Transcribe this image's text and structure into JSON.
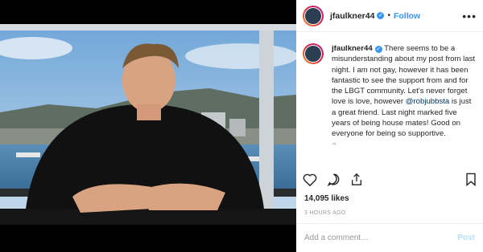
{
  "header": {
    "username": "jfaulkner44",
    "separator": "•",
    "follow_label": "Follow",
    "more_label": "•••"
  },
  "post": {
    "username": "jfaulkner44",
    "caption_part1": " There seems to be a misunderstanding about my post from last night. I am not gay, however it has been fantastic to see the support from and for the LBGT community. Let's never forget love is love, however ",
    "mention": "@robjubbsta",
    "caption_part2": " is just a great friend. Last night marked five years of being house mates! Good on everyone for being so supportive.",
    "truncated_marker": "ᵐᴸ",
    "likes": "14,095 likes",
    "time_ago": "3 HOURS AGO"
  },
  "comment": {
    "placeholder": "Add a comment…",
    "post_label": "Post"
  },
  "icons": {
    "like": "heart-icon",
    "comment": "comment-icon",
    "share": "share-icon",
    "save": "bookmark-icon",
    "verified": "verified-badge-icon"
  },
  "colors": {
    "link_blue": "#3897f0",
    "mention_blue": "#003569",
    "text": "#262626",
    "muted": "#999999",
    "post_disabled": "#b2dffc"
  }
}
